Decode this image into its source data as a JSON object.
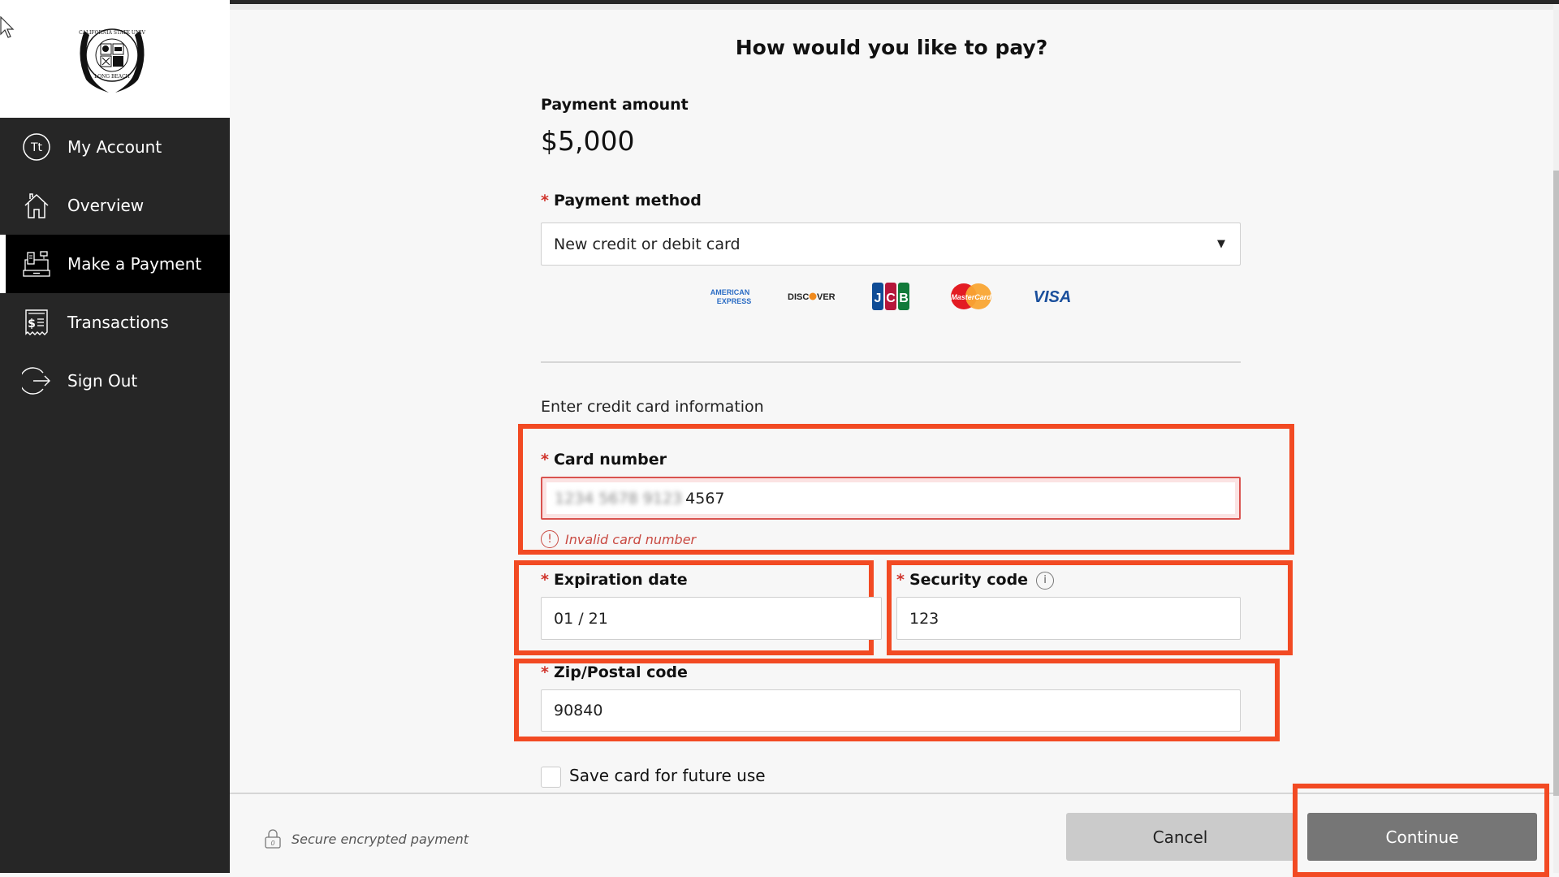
{
  "sidebar": {
    "logo_alt": "California State University Long Beach seal",
    "items": [
      {
        "label": "My Account",
        "icon": "account-initials-icon",
        "icon_text": "Tt",
        "active": false
      },
      {
        "label": "Overview",
        "icon": "home-icon",
        "active": false
      },
      {
        "label": "Make a Payment",
        "icon": "cash-register-icon",
        "active": true
      },
      {
        "label": "Transactions",
        "icon": "receipt-icon",
        "active": false
      },
      {
        "label": "Sign Out",
        "icon": "sign-out-icon",
        "active": false
      }
    ]
  },
  "page": {
    "title": "How would you like to pay?"
  },
  "payment": {
    "amount_label": "Payment amount",
    "amount_value": "$5,000",
    "method_label": "Payment method",
    "method_value": "New credit or debit card",
    "card_brands": [
      "American Express",
      "Discover",
      "JCB",
      "MasterCard",
      "VISA"
    ]
  },
  "card_form": {
    "section_label": "Enter credit card information",
    "required_mark": "*",
    "card_number_label": "Card number",
    "card_number_masked": "1234 5678 9123",
    "card_number_visible": "4567",
    "card_number_error": "Invalid card number",
    "expiration_label": "Expiration date",
    "expiration_value": "01 / 21",
    "security_label": "Security code",
    "security_value": "123",
    "zip_label": "Zip/Postal code",
    "zip_value": "90840",
    "save_card_label": "Save card for future use",
    "save_card_checked": false
  },
  "footer": {
    "secure_text": "Secure encrypted payment",
    "cancel_label": "Cancel",
    "continue_label": "Continue"
  },
  "colors": {
    "sidebar_bg": "#262626",
    "active_bg": "#000000",
    "highlight": "#f24a23",
    "required": "#d0342c",
    "error": "#c94a42",
    "continue_bg": "#767676",
    "cancel_bg": "#cbcbcb"
  }
}
